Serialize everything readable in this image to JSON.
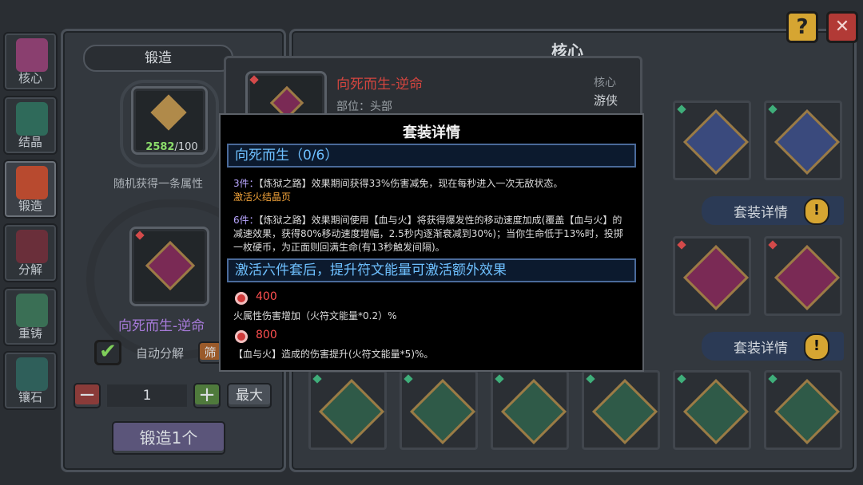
{
  "top_buttons": {
    "help": "?",
    "close": "✕"
  },
  "tabs": [
    {
      "label": "核心",
      "icon": "core-icon",
      "color": "#8a3f6f"
    },
    {
      "label": "结晶",
      "icon": "crystal-icon",
      "color": "#2f6a5a"
    },
    {
      "label": "锻造",
      "icon": "forge-icon",
      "color": "#b84a2f"
    },
    {
      "label": "分解",
      "icon": "decompose-icon",
      "color": "#6a2f3a"
    },
    {
      "label": "重铸",
      "icon": "recast-icon",
      "color": "#3a6f55"
    },
    {
      "label": "镶石",
      "icon": "inlay-icon",
      "color": "#2f5f5a"
    }
  ],
  "forge": {
    "title": "锻造",
    "material_count": "2582",
    "material_required": "/100",
    "desc": "随机获得一条属性",
    "item_name": "向死而生-逆命",
    "auto_decompose": "自动分解",
    "filter_btn": "筛",
    "qty": "1",
    "minus": "−",
    "plus": "+",
    "max": "最大",
    "forge_btn": "锻造1个"
  },
  "core_panel": {
    "header": "核心",
    "set_detail_label": "套装详情",
    "excl": "!"
  },
  "detail_card": {
    "name": "向死而生-逆命",
    "slot_label": "部位：头部",
    "type_label": "核心",
    "class_label": "游侠"
  },
  "modal": {
    "title": "套装详情",
    "set_name": "向死而生（0/6）",
    "p3_label": "3件：",
    "p3_text": "【炼狱之路】效果期间获得33%伤害减免，现在每秒进入一次无敌状态。",
    "p3_activate": "激活火结晶页",
    "p6_label": "6件：",
    "p6_text": "【炼狱之路】效果期间使用【血与火】将获得爆发性的移动速度加成(覆盖【血与火】的减速效果，获得80%移动速度增幅，2.5秒内逐渐衰减到30%)；当你生命低于13%时，投掷一枚硬币，为正面则回满生命(有13秒触发间隔)。",
    "bonus_header": "激活六件套后，提升符文能量可激活额外效果",
    "tier1_value": "400",
    "tier1_text": "火属性伤害增加（火符文能量*0.2）%",
    "tier2_value": "800",
    "tier2_text": "【血与火】造成的伤害提升(火符文能量*5)%。"
  }
}
